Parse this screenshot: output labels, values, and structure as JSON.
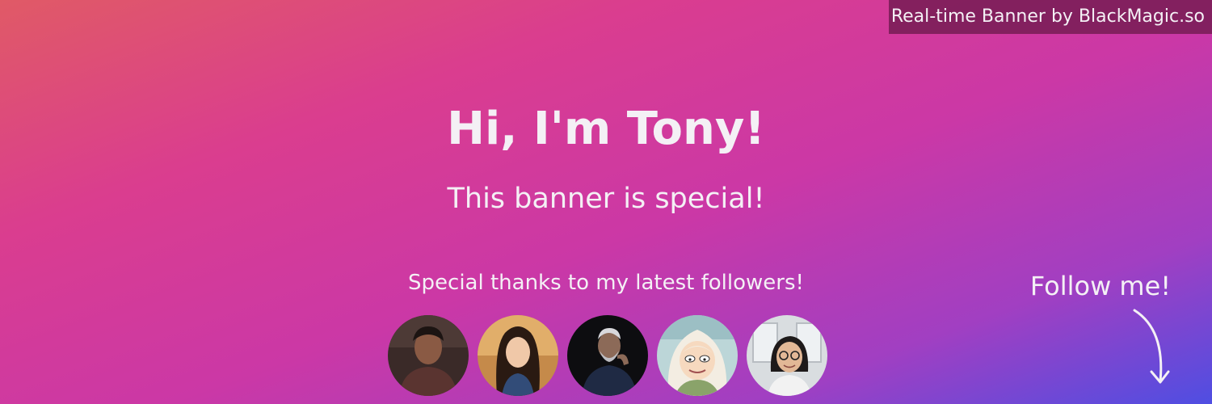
{
  "banner": {
    "tag": "Real-time Banner by BlackMagic.so",
    "headline": "Hi, I'm Tony!",
    "subline": "This banner is special!",
    "thanks": "Special thanks to my latest followers!",
    "follow": "Follow me!"
  },
  "colors": {
    "gradient_start": "#e05a66",
    "gradient_middle": "#cb38a6",
    "gradient_end": "#4f4ee2",
    "tag_background": "#761c54",
    "text": "#f4f0f5"
  },
  "followers": {
    "count_shown": 5,
    "avatars": [
      "man-in-dark-room",
      "woman-in-warm-light",
      "bearded-man-in-dark",
      "cartoon-princess-character",
      "smiling-woman-with-glasses"
    ]
  },
  "icons": [
    "curved-down-arrow-icon"
  ]
}
